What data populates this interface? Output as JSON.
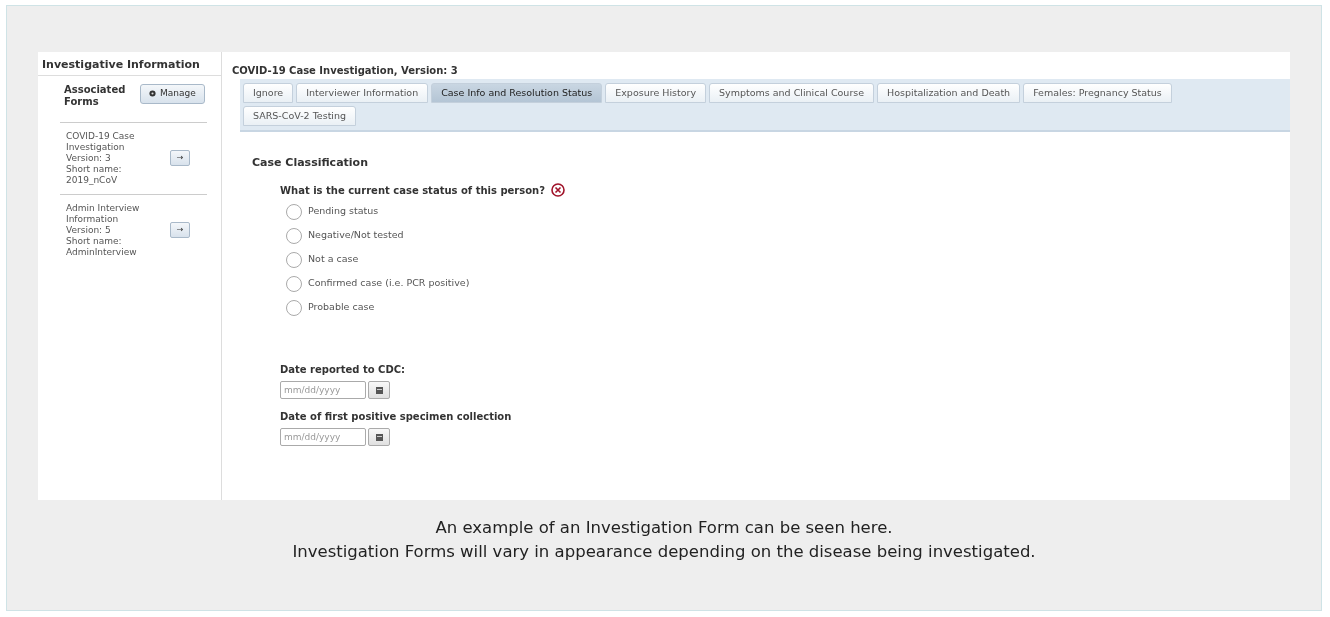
{
  "section_title": "Investigative Information",
  "associated_forms": {
    "label": "Associated Forms",
    "manage_button": "Manage",
    "forms": [
      {
        "name": "COVID-19 Case Investigation",
        "version": "Version: 3",
        "short_name_label": "Short name:",
        "short_name": "2019_nCoV",
        "open_button": "→"
      },
      {
        "name": "Admin Interview Information",
        "version": "Version: 5",
        "short_name_label": "Short name:",
        "short_name": "AdminInterview",
        "open_button": "→"
      }
    ]
  },
  "form_title": "COVID-19 Case Investigation, Version: 3",
  "tabs": [
    {
      "label": "Ignore",
      "selected": false
    },
    {
      "label": "Interviewer Information",
      "selected": false
    },
    {
      "label": "Case Info and Resolution Status",
      "selected": true
    },
    {
      "label": "Exposure History",
      "selected": false
    },
    {
      "label": "Symptoms and Clinical Course",
      "selected": false
    },
    {
      "label": "Hospitalization and Death",
      "selected": false
    },
    {
      "label": "Females: Pregnancy Status",
      "selected": false
    },
    {
      "label": "SARS-CoV-2 Testing",
      "selected": false
    }
  ],
  "section_heading": "Case Classification",
  "question": {
    "label": "What is the current case status of this person?",
    "required": true,
    "options": [
      {
        "label": "Pending status",
        "selected": false
      },
      {
        "label": "Negative/Not tested",
        "selected": false
      },
      {
        "label": "Not a case",
        "selected": false
      },
      {
        "label": "Confirmed case (i.e. PCR positive)",
        "selected": false
      },
      {
        "label": "Probable case",
        "selected": false
      }
    ]
  },
  "date_fields": [
    {
      "label": "Date reported to CDC:",
      "placeholder": "mm/dd/yyyy"
    },
    {
      "label": "Date of first positive specimen collection",
      "placeholder": "mm/dd/yyyy"
    }
  ],
  "caption": [
    "An example of an Investigation Form can be seen here.",
    "Investigation Forms will vary in appearance depending on the disease being investigated."
  ]
}
